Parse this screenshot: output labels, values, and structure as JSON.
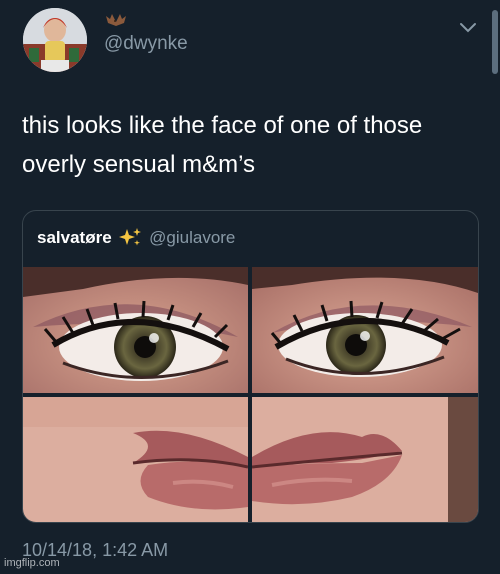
{
  "tweet": {
    "handle": "@dwynke",
    "text_line1": "this looks like the face of one of those",
    "text_line2": "overly sensual m&m’s",
    "timestamp": "10/14/18, 1:42 AM"
  },
  "quoted_tweet": {
    "display_name": "salvatøre",
    "handle": "@giulavore"
  },
  "icons": {
    "display_name_emoji": "bat-emoji-icon",
    "quoted_name_emoji": "sparkles-icon",
    "menu": "chevron-down-icon"
  },
  "colors": {
    "background": "#15202b",
    "text_primary": "#ffffff",
    "text_secondary": "#8899a6",
    "card_border": "#38444d"
  },
  "watermark": "imgflip.com"
}
